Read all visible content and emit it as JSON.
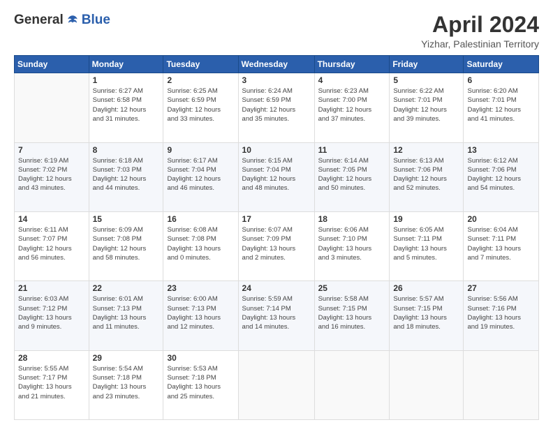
{
  "header": {
    "logo_general": "General",
    "logo_blue": "Blue",
    "month_year": "April 2024",
    "location": "Yizhar, Palestinian Territory"
  },
  "days_of_week": [
    "Sunday",
    "Monday",
    "Tuesday",
    "Wednesday",
    "Thursday",
    "Friday",
    "Saturday"
  ],
  "weeks": [
    [
      {
        "day": "",
        "info": ""
      },
      {
        "day": "1",
        "info": "Sunrise: 6:27 AM\nSunset: 6:58 PM\nDaylight: 12 hours\nand 31 minutes."
      },
      {
        "day": "2",
        "info": "Sunrise: 6:25 AM\nSunset: 6:59 PM\nDaylight: 12 hours\nand 33 minutes."
      },
      {
        "day": "3",
        "info": "Sunrise: 6:24 AM\nSunset: 6:59 PM\nDaylight: 12 hours\nand 35 minutes."
      },
      {
        "day": "4",
        "info": "Sunrise: 6:23 AM\nSunset: 7:00 PM\nDaylight: 12 hours\nand 37 minutes."
      },
      {
        "day": "5",
        "info": "Sunrise: 6:22 AM\nSunset: 7:01 PM\nDaylight: 12 hours\nand 39 minutes."
      },
      {
        "day": "6",
        "info": "Sunrise: 6:20 AM\nSunset: 7:01 PM\nDaylight: 12 hours\nand 41 minutes."
      }
    ],
    [
      {
        "day": "7",
        "info": "Sunrise: 6:19 AM\nSunset: 7:02 PM\nDaylight: 12 hours\nand 43 minutes."
      },
      {
        "day": "8",
        "info": "Sunrise: 6:18 AM\nSunset: 7:03 PM\nDaylight: 12 hours\nand 44 minutes."
      },
      {
        "day": "9",
        "info": "Sunrise: 6:17 AM\nSunset: 7:04 PM\nDaylight: 12 hours\nand 46 minutes."
      },
      {
        "day": "10",
        "info": "Sunrise: 6:15 AM\nSunset: 7:04 PM\nDaylight: 12 hours\nand 48 minutes."
      },
      {
        "day": "11",
        "info": "Sunrise: 6:14 AM\nSunset: 7:05 PM\nDaylight: 12 hours\nand 50 minutes."
      },
      {
        "day": "12",
        "info": "Sunrise: 6:13 AM\nSunset: 7:06 PM\nDaylight: 12 hours\nand 52 minutes."
      },
      {
        "day": "13",
        "info": "Sunrise: 6:12 AM\nSunset: 7:06 PM\nDaylight: 12 hours\nand 54 minutes."
      }
    ],
    [
      {
        "day": "14",
        "info": "Sunrise: 6:11 AM\nSunset: 7:07 PM\nDaylight: 12 hours\nand 56 minutes."
      },
      {
        "day": "15",
        "info": "Sunrise: 6:09 AM\nSunset: 7:08 PM\nDaylight: 12 hours\nand 58 minutes."
      },
      {
        "day": "16",
        "info": "Sunrise: 6:08 AM\nSunset: 7:08 PM\nDaylight: 13 hours\nand 0 minutes."
      },
      {
        "day": "17",
        "info": "Sunrise: 6:07 AM\nSunset: 7:09 PM\nDaylight: 13 hours\nand 2 minutes."
      },
      {
        "day": "18",
        "info": "Sunrise: 6:06 AM\nSunset: 7:10 PM\nDaylight: 13 hours\nand 3 minutes."
      },
      {
        "day": "19",
        "info": "Sunrise: 6:05 AM\nSunset: 7:11 PM\nDaylight: 13 hours\nand 5 minutes."
      },
      {
        "day": "20",
        "info": "Sunrise: 6:04 AM\nSunset: 7:11 PM\nDaylight: 13 hours\nand 7 minutes."
      }
    ],
    [
      {
        "day": "21",
        "info": "Sunrise: 6:03 AM\nSunset: 7:12 PM\nDaylight: 13 hours\nand 9 minutes."
      },
      {
        "day": "22",
        "info": "Sunrise: 6:01 AM\nSunset: 7:13 PM\nDaylight: 13 hours\nand 11 minutes."
      },
      {
        "day": "23",
        "info": "Sunrise: 6:00 AM\nSunset: 7:13 PM\nDaylight: 13 hours\nand 12 minutes."
      },
      {
        "day": "24",
        "info": "Sunrise: 5:59 AM\nSunset: 7:14 PM\nDaylight: 13 hours\nand 14 minutes."
      },
      {
        "day": "25",
        "info": "Sunrise: 5:58 AM\nSunset: 7:15 PM\nDaylight: 13 hours\nand 16 minutes."
      },
      {
        "day": "26",
        "info": "Sunrise: 5:57 AM\nSunset: 7:15 PM\nDaylight: 13 hours\nand 18 minutes."
      },
      {
        "day": "27",
        "info": "Sunrise: 5:56 AM\nSunset: 7:16 PM\nDaylight: 13 hours\nand 19 minutes."
      }
    ],
    [
      {
        "day": "28",
        "info": "Sunrise: 5:55 AM\nSunset: 7:17 PM\nDaylight: 13 hours\nand 21 minutes."
      },
      {
        "day": "29",
        "info": "Sunrise: 5:54 AM\nSunset: 7:18 PM\nDaylight: 13 hours\nand 23 minutes."
      },
      {
        "day": "30",
        "info": "Sunrise: 5:53 AM\nSunset: 7:18 PM\nDaylight: 13 hours\nand 25 minutes."
      },
      {
        "day": "",
        "info": ""
      },
      {
        "day": "",
        "info": ""
      },
      {
        "day": "",
        "info": ""
      },
      {
        "day": "",
        "info": ""
      }
    ]
  ]
}
